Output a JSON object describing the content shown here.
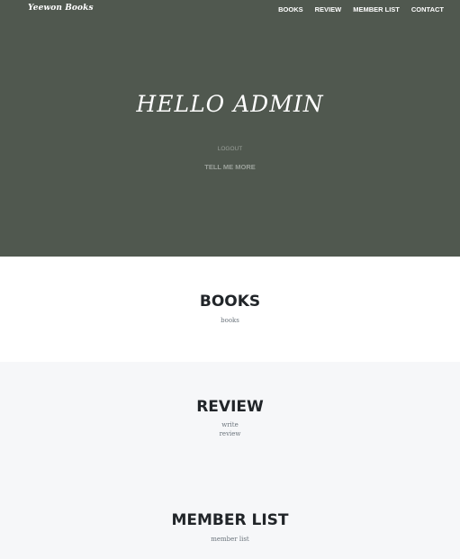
{
  "navbar": {
    "brand": "Yeewon Books",
    "links": [
      "BOOKS",
      "REVIEW",
      "MEMBER LIST",
      "CONTACT"
    ]
  },
  "hero": {
    "title": "HELLO ADMIN",
    "logout": "LOGOUT",
    "cta": "TELL ME MORE"
  },
  "sections": {
    "books": {
      "heading": "BOOKS",
      "sub": "books"
    },
    "review": {
      "heading": "REVIEW",
      "sub": [
        "write",
        "review"
      ]
    },
    "members": {
      "heading": "MEMBER LIST",
      "sub": "member list"
    }
  },
  "colors": {
    "hero_bg": "#50584f",
    "alt_bg": "#f6f7f9",
    "heading": "#212529",
    "muted": "#6c757d"
  }
}
